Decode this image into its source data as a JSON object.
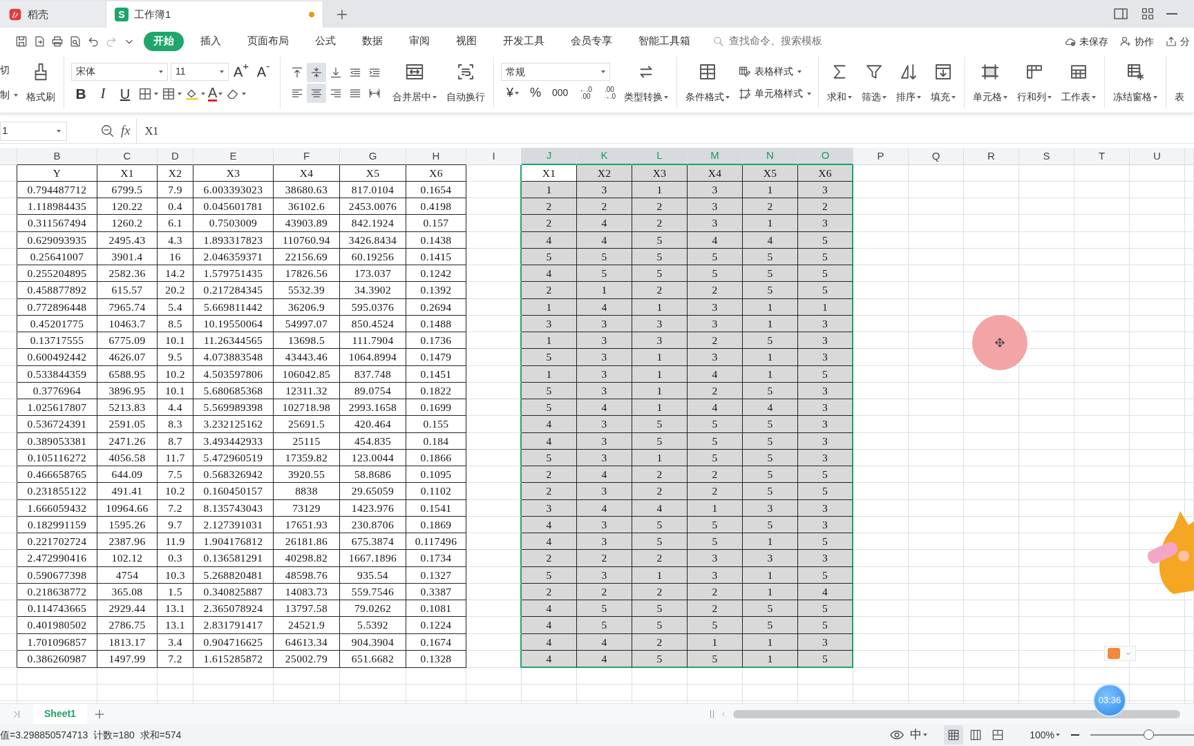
{
  "window_tabs": [
    {
      "label": "稻壳",
      "selected": false,
      "unsaved": false
    },
    {
      "label": "工作簿1",
      "selected": true,
      "logo": "S",
      "unsaved": true
    }
  ],
  "menu": [
    {
      "label": "开始",
      "selected": true
    },
    {
      "label": "插入",
      "selected": false
    },
    {
      "label": "页面布局",
      "selected": false
    },
    {
      "label": "公式",
      "selected": false
    },
    {
      "label": "数据",
      "selected": false
    },
    {
      "label": "审阅",
      "selected": false
    },
    {
      "label": "视图",
      "selected": false
    },
    {
      "label": "开发工具",
      "selected": false
    },
    {
      "label": "会员专享",
      "selected": false
    },
    {
      "label": "智能工具箱",
      "selected": false
    }
  ],
  "search": {
    "placeholder": "查找命令、搜索模板"
  },
  "actions": [
    "未保存",
    "协作",
    "分"
  ],
  "ribbon": {
    "clipboard": [
      "切",
      "制",
      "格式刷"
    ],
    "font": {
      "name": "宋体",
      "size": "11",
      "grow": "A$^{+}$",
      "shrink": "A$^{-}$",
      "styles": [
        "B",
        "I",
        "U"
      ],
      "color_letter": "A"
    },
    "align": [
      {
        "selected": false
      },
      {
        "selected": true
      },
      {
        "selected": false
      },
      {
        "selected": false
      },
      {
        "selected": false
      },
      {
        "selected": false
      },
      {
        "selected": true
      },
      {
        "selected": false
      },
      {
        "selected": false
      },
      {
        "selected": false
      }
    ],
    "merge": "合并居中",
    "wrap": "自动换行",
    "number": {
      "format": "常规",
      "symbols": [
        "¥",
        "%",
        "000"
      ],
      "increase": [
        "←.0",
        ".00"
      ],
      "decrease": [
        ".00",
        "→.0"
      ],
      "convert": "类型转换"
    },
    "tool_groups": [
      [
        {
          "label": "条件格式",
          "kind": "large"
        },
        {
          "label": "表格样式",
          "kind": "small"
        },
        {
          "label": "单元格样式",
          "kind": "small"
        }
      ],
      [
        {
          "label": "求和",
          "kind": "large"
        },
        {
          "label": "筛选",
          "kind": "large"
        },
        {
          "label": "排序",
          "kind": "large"
        },
        {
          "label": "填充",
          "kind": "large"
        }
      ],
      [
        {
          "label": "单元格",
          "kind": "large"
        },
        {
          "label": "行和列",
          "kind": "large"
        },
        {
          "label": "工作表",
          "kind": "large"
        }
      ],
      [
        {
          "label": "冻结窗格",
          "kind": "large"
        }
      ],
      [
        {
          "label": "表",
          "kind": "large"
        }
      ]
    ]
  },
  "formula_bar": {
    "name_box": "1",
    "function_label": "fx",
    "formula": "X1"
  },
  "sheet": {
    "columns": [
      {
        "label": "B",
        "selected": false
      },
      {
        "label": "C",
        "selected": false
      },
      {
        "label": "D",
        "selected": false
      },
      {
        "label": "E",
        "selected": false
      },
      {
        "label": "F",
        "selected": false
      },
      {
        "label": "G",
        "selected": false
      },
      {
        "label": "H",
        "selected": false
      },
      {
        "label": "I",
        "selected": false
      },
      {
        "label": "J",
        "selected": true
      },
      {
        "label": "K",
        "selected": true
      },
      {
        "label": "L",
        "selected": true
      },
      {
        "label": "M",
        "selected": true
      },
      {
        "label": "N",
        "selected": true
      },
      {
        "label": "O",
        "selected": true
      },
      {
        "label": "P",
        "selected": false
      },
      {
        "label": "Q",
        "selected": false
      },
      {
        "label": "R",
        "selected": false
      },
      {
        "label": "S",
        "selected": false
      },
      {
        "label": "T",
        "selected": false
      },
      {
        "label": "U",
        "selected": false
      }
    ],
    "left_table": {
      "header": [
        "Y",
        "X1",
        "X2",
        "X3",
        "X4",
        "X5",
        "X6"
      ],
      "rows": [
        [
          "0.794487712",
          "6799.5",
          "7.9",
          "6.003393023",
          "38680.63",
          "817.0104",
          "0.1654"
        ],
        [
          "1.118984435",
          "120.22",
          "0.4",
          "0.045601781",
          "36102.6",
          "2453.0076",
          "0.4198"
        ],
        [
          "0.311567494",
          "1260.2",
          "6.1",
          "0.7503009",
          "43903.89",
          "842.1924",
          "0.157"
        ],
        [
          "0.629093935",
          "2495.43",
          "4.3",
          "1.893317823",
          "110760.94",
          "3426.8434",
          "0.1438"
        ],
        [
          "0.25641007",
          "3901.4",
          "16",
          "2.046359371",
          "22156.69",
          "60.19256",
          "0.1415"
        ],
        [
          "0.255204895",
          "2582.36",
          "14.2",
          "1.579751435",
          "17826.56",
          "173.037",
          "0.1242"
        ],
        [
          "0.458877892",
          "615.57",
          "20.2",
          "0.217284345",
          "5532.39",
          "34.3902",
          "0.1392"
        ],
        [
          "0.772896448",
          "7965.74",
          "5.4",
          "5.669811442",
          "36206.9",
          "595.0376",
          "0.2694"
        ],
        [
          "0.45201775",
          "10463.7",
          "8.5",
          "10.19550064",
          "54997.07",
          "850.4524",
          "0.1488"
        ],
        [
          "0.13717555",
          "6775.09",
          "10.1",
          "11.26344565",
          "13698.5",
          "111.7904",
          "0.1736"
        ],
        [
          "0.600492442",
          "4626.07",
          "9.5",
          "4.073883548",
          "43443.46",
          "1064.8994",
          "0.1479"
        ],
        [
          "0.533844359",
          "6588.95",
          "10.2",
          "4.503597806",
          "106042.85",
          "837.748",
          "0.1451"
        ],
        [
          "0.3776964",
          "3896.95",
          "10.1",
          "5.680685368",
          "12311.32",
          "89.0754",
          "0.1822"
        ],
        [
          "1.025617807",
          "5213.83",
          "4.4",
          "5.569989398",
          "102718.98",
          "2993.1658",
          "0.1699"
        ],
        [
          "0.536724391",
          "2591.05",
          "8.3",
          "3.232125162",
          "25691.5",
          "420.464",
          "0.155"
        ],
        [
          "0.389053381",
          "2471.26",
          "8.7",
          "3.493442933",
          "25115",
          "454.835",
          "0.184"
        ],
        [
          "0.105116272",
          "4056.58",
          "11.7",
          "5.472960519",
          "17359.82",
          "123.0044",
          "0.1866"
        ],
        [
          "0.466658765",
          "644.09",
          "7.5",
          "0.568326942",
          "3920.55",
          "58.8686",
          "0.1095"
        ],
        [
          "0.231855122",
          "491.41",
          "10.2",
          "0.160450157",
          "8838",
          "29.65059",
          "0.1102"
        ],
        [
          "1.666059432",
          "10964.66",
          "7.2",
          "8.135743043",
          "73129",
          "1423.976",
          "0.1541"
        ],
        [
          "0.182991159",
          "1595.26",
          "9.7",
          "2.127391031",
          "17651.93",
          "230.8706",
          "0.1869"
        ],
        [
          "0.221702724",
          "2387.96",
          "11.9",
          "1.904176812",
          "26181.86",
          "675.3874",
          "0.117496"
        ],
        [
          "2.472990416",
          "102.12",
          "0.3",
          "0.136581291",
          "40298.82",
          "1667.1896",
          "0.1734"
        ],
        [
          "0.590677398",
          "4754",
          "10.3",
          "5.268820481",
          "48598.76",
          "935.54",
          "0.1327"
        ],
        [
          "0.218638772",
          "365.08",
          "1.5",
          "0.340825887",
          "14083.73",
          "559.7546",
          "0.3387"
        ],
        [
          "0.114743665",
          "2929.44",
          "13.1",
          "2.365078924",
          "13797.58",
          "79.0262",
          "0.1081"
        ],
        [
          "0.401980502",
          "2786.75",
          "13.1",
          "2.831791417",
          "24521.9",
          "5.5392",
          "0.1224"
        ],
        [
          "1.701096857",
          "1813.17",
          "3.4",
          "0.904716625",
          "64613.34",
          "904.3904",
          "0.1674"
        ],
        [
          "0.386260987",
          "1497.99",
          "7.2",
          "1.615285872",
          "25002.79",
          "651.6682",
          "0.1328"
        ]
      ]
    },
    "right_table": {
      "selected": true,
      "header": [
        {
          "label": "X1",
          "active": true
        },
        {
          "label": "X2",
          "active": false
        },
        {
          "label": "X3",
          "active": false
        },
        {
          "label": "X4",
          "active": false
        },
        {
          "label": "X5",
          "active": false
        },
        {
          "label": "X6",
          "active": false
        }
      ],
      "rows": [
        [
          "1",
          "3",
          "1",
          "3",
          "1",
          "3"
        ],
        [
          "2",
          "2",
          "2",
          "3",
          "2",
          "2"
        ],
        [
          "2",
          "4",
          "2",
          "3",
          "1",
          "3"
        ],
        [
          "4",
          "4",
          "5",
          "4",
          "4",
          "5"
        ],
        [
          "5",
          "5",
          "5",
          "5",
          "5",
          "5"
        ],
        [
          "4",
          "5",
          "5",
          "5",
          "5",
          "5"
        ],
        [
          "2",
          "1",
          "2",
          "2",
          "5",
          "5"
        ],
        [
          "1",
          "4",
          "1",
          "3",
          "1",
          "1"
        ],
        [
          "3",
          "3",
          "3",
          "3",
          "1",
          "3"
        ],
        [
          "1",
          "3",
          "3",
          "2",
          "5",
          "3"
        ],
        [
          "5",
          "3",
          "1",
          "3",
          "1",
          "3"
        ],
        [
          "1",
          "3",
          "1",
          "4",
          "1",
          "5"
        ],
        [
          "5",
          "3",
          "1",
          "2",
          "5",
          "3"
        ],
        [
          "5",
          "4",
          "1",
          "4",
          "4",
          "3"
        ],
        [
          "4",
          "3",
          "5",
          "5",
          "5",
          "3"
        ],
        [
          "4",
          "3",
          "5",
          "5",
          "5",
          "3"
        ],
        [
          "5",
          "3",
          "1",
          "5",
          "5",
          "3"
        ],
        [
          "2",
          "4",
          "2",
          "2",
          "5",
          "5"
        ],
        [
          "2",
          "3",
          "2",
          "2",
          "5",
          "5"
        ],
        [
          "3",
          "4",
          "4",
          "1",
          "3",
          "3"
        ],
        [
          "4",
          "3",
          "5",
          "5",
          "5",
          "3"
        ],
        [
          "4",
          "3",
          "5",
          "5",
          "1",
          "5"
        ],
        [
          "2",
          "2",
          "2",
          "3",
          "3",
          "3"
        ],
        [
          "5",
          "3",
          "1",
          "3",
          "1",
          "5"
        ],
        [
          "2",
          "2",
          "2",
          "2",
          "1",
          "4"
        ],
        [
          "4",
          "5",
          "5",
          "2",
          "5",
          "5"
        ],
        [
          "4",
          "5",
          "5",
          "5",
          "5",
          "5"
        ],
        [
          "4",
          "4",
          "2",
          "1",
          "1",
          "3"
        ],
        [
          "4",
          "4",
          "5",
          "5",
          "1",
          "5"
        ]
      ]
    }
  },
  "sheet_tabs": [
    {
      "label": "Sheet1",
      "selected": true
    }
  ],
  "status_bar": {
    "items": [
      "值=3.298850574713",
      "计数=180",
      "求和=574"
    ],
    "input_mode": "中",
    "views": [
      {
        "selected": true
      },
      {
        "selected": false
      },
      {
        "selected": false
      }
    ],
    "zoom": "100%",
    "zoom_slider": {
      "level": 0.57
    }
  },
  "recording": {
    "timer": "03:36"
  }
}
